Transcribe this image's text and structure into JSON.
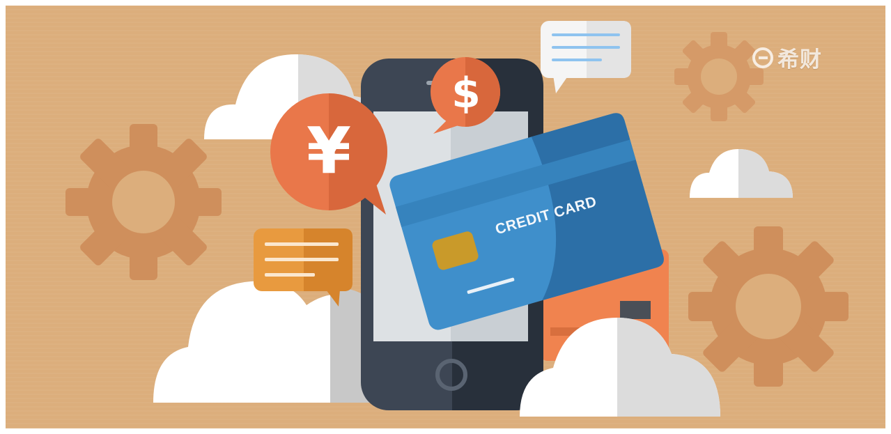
{
  "image": {
    "description_free": true
  },
  "card": {
    "label": "CREDIT CARD"
  },
  "bubbles": {
    "yen_symbol": "¥",
    "dollar_symbol": "$"
  },
  "watermark": {
    "text": "希财"
  },
  "colors": {
    "background": "#dcae7c",
    "gear": "#cf8f5c",
    "cloud": "#ffffff",
    "cloud_shade": "#dcdcdc",
    "phone_body": "#3d4654",
    "phone_screen": "#dde1e4",
    "card_blue": "#3f8fcb",
    "card_blue_dark": "#2c6fa7",
    "card_orange": "#f0834f",
    "bubble_orange": "#e9774a",
    "bubble_yellow": "#e89a3f",
    "bubble_white": "#f5f5f5",
    "chip": "#c99a2a"
  },
  "icons": [
    "gear-icon",
    "cloud-icon",
    "smartphone-icon",
    "credit-card-icon",
    "yen-bubble-icon",
    "dollar-bubble-icon",
    "chat-bubble-icon"
  ]
}
